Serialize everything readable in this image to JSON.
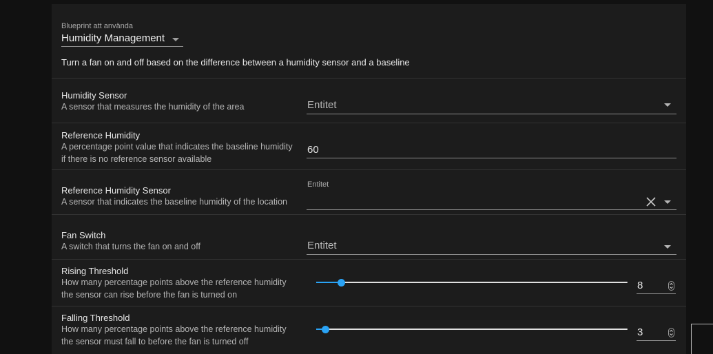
{
  "blueprint": {
    "label": "Blueprint att använda",
    "value": "Humidity Management",
    "description": "Turn a fan on and off based on the difference between a humidity sensor and a baseline"
  },
  "inputs": {
    "humidity_sensor": {
      "title": "Humidity Sensor",
      "description": "A sensor that measures the humidity of the area",
      "placeholder": "Entitet"
    },
    "reference_humidity": {
      "title": "Reference Humidity",
      "description": "A percentage point value that indicates the baseline humidity if there is no reference sensor available",
      "value": "60"
    },
    "reference_humidity_sensor": {
      "title": "Reference Humidity Sensor",
      "description": "A sensor that indicates the baseline humidity of the location",
      "label": "Entitet"
    },
    "fan_switch": {
      "title": "Fan Switch",
      "description": "A switch that turns the fan on and off",
      "placeholder": "Entitet"
    },
    "rising_threshold": {
      "title": "Rising Threshold",
      "description": "How many percentage points above the reference humidity the sensor can rise before the fan is turned on",
      "value": "8",
      "fraction": 0.08
    },
    "falling_threshold": {
      "title": "Falling Threshold",
      "description": "How many percentage points above the reference humidity the sensor must fall to before the fan is turned off",
      "value": "3",
      "fraction": 0.03
    }
  },
  "colors": {
    "accent": "#2aa3f5",
    "card": "#1c1c1c",
    "background": "#111111"
  }
}
